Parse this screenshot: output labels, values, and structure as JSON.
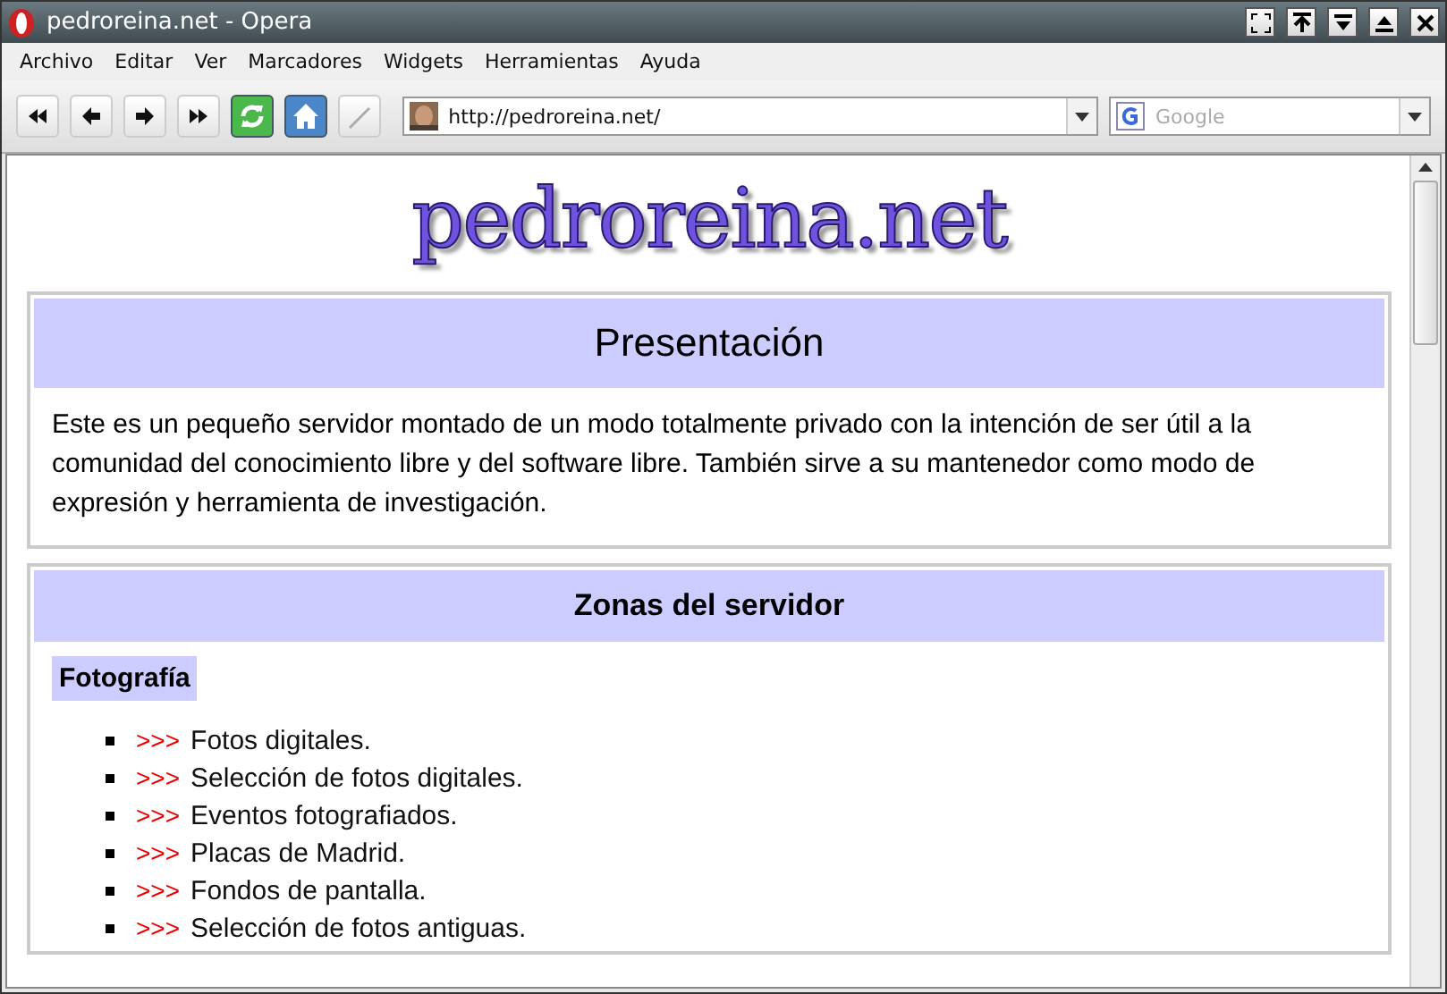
{
  "window": {
    "title": "pedroreina.net - Opera"
  },
  "menu": [
    "Archivo",
    "Editar",
    "Ver",
    "Marcadores",
    "Widgets",
    "Herramientas",
    "Ayuda"
  ],
  "toolbar": {
    "address": "http://pedroreina.net/",
    "search": {
      "placeholder": "Google"
    }
  },
  "page": {
    "logo": "pedroreina.net",
    "intro": {
      "title": "Presentación",
      "text": "Este es un pequeño servidor montado de un modo totalmente privado con la intención de ser útil a la comunidad del conocimiento libre y del software libre. También sirve a su mantenedor como modo de expresión y herramienta de investigación."
    },
    "zones": {
      "title": "Zonas del servidor",
      "section": "Fotografía",
      "marker": ">>>",
      "links": [
        "Fotos digitales.",
        "Selección de fotos digitales.",
        "Eventos fotografiados.",
        "Placas de Madrid.",
        "Fondos de pantalla.",
        "Selección de fotos antiguas."
      ]
    }
  }
}
